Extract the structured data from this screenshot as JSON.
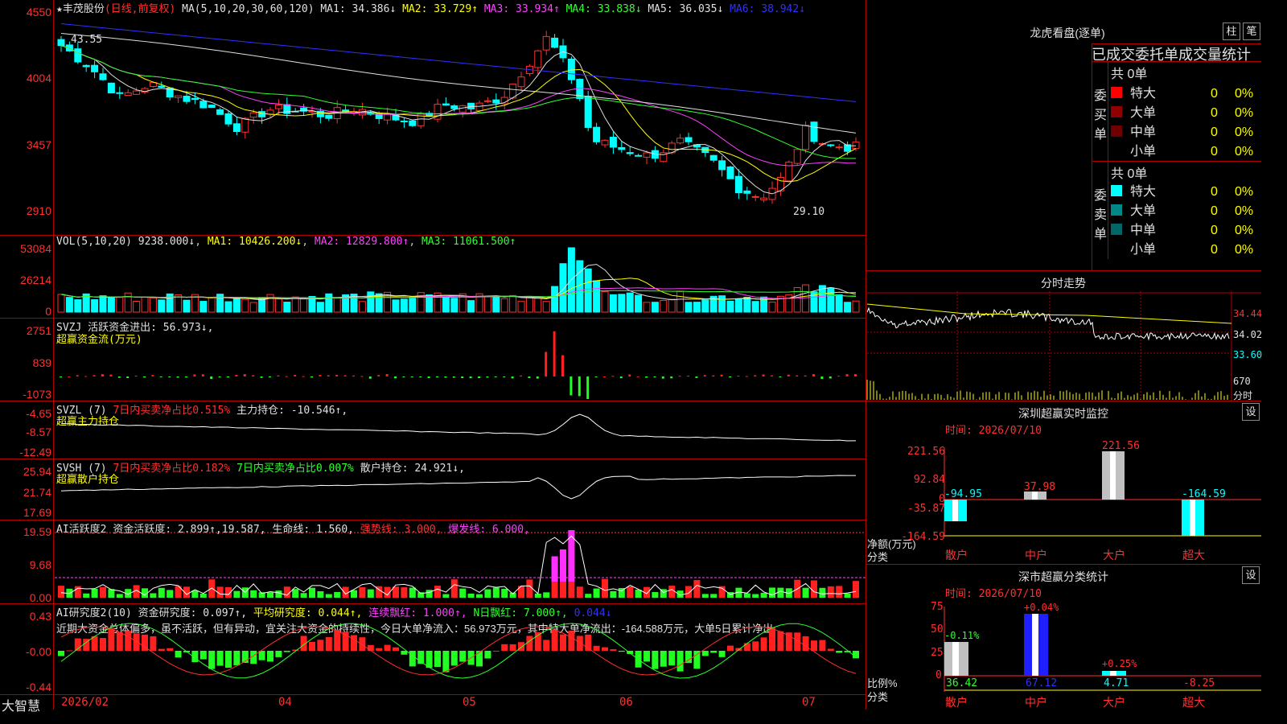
{
  "header": {
    "star": "★",
    "stock": "丰茂股份",
    "period": "(日线,前复权)",
    "ma_label": "MA(5,10,20,30,60,120)",
    "ma": [
      {
        "k": "MA1:",
        "v": "34.386↓",
        "c": "#e0e0e0"
      },
      {
        "k": "MA2:",
        "v": "33.729↑",
        "c": "#ffff00"
      },
      {
        "k": "MA3:",
        "v": "33.934↑",
        "c": "#ff40ff"
      },
      {
        "k": "MA4:",
        "v": "33.838↓",
        "c": "#30ff30"
      },
      {
        "k": "MA5:",
        "v": "36.035↓",
        "c": "#e0e0e0"
      },
      {
        "k": "MA6:",
        "v": "38.942↓",
        "c": "#3030ff"
      }
    ]
  },
  "price": {
    "yticks": [
      "4550",
      "4004",
      "3457",
      "2910"
    ],
    "high_label": "43.55",
    "low_label": "29.10"
  },
  "vol": {
    "title": "VOL(5,10,20)",
    "value": "9238.000↓",
    "ma1": "MA1: 10426.200↓",
    "ma2": "MA2: 12829.800↑",
    "ma3": "MA3: 11061.500↑",
    "yticks": [
      "53084",
      "26214",
      "0"
    ]
  },
  "svzj": {
    "title": "SVZJ  活跃资金进出: 56.973↓,",
    "sub": "超赢资金流(万元)",
    "yticks": [
      "2751",
      "839",
      "-1073"
    ]
  },
  "svzl": {
    "title": "SVZL (7)",
    "t1": "7日内买卖净占比0.515%",
    "t2": "主力持仓: -10.546↑,",
    "sub": "超赢主力持仓",
    "yticks": [
      "-4.65",
      "-8.57",
      "-12.49"
    ]
  },
  "svsh": {
    "title": "SVSH (7)",
    "t1": "7日内买卖净占比0.182%",
    "t2": "7日内买卖净占比0.007%",
    "t3": "散户持仓: 24.921↓,",
    "sub": "超赢散户持仓",
    "yticks": [
      "25.94",
      "21.74",
      "17.69"
    ]
  },
  "ai1": {
    "title": "AI活跃度2",
    "t1": "资金活跃度: 2.899↑,19.587,",
    "t2": "生命线: 1.560,",
    "t3": "强势线: 3.000,",
    "t4": "爆发线: 6.000,",
    "yticks": [
      "19.59",
      "9.68",
      "0.00"
    ]
  },
  "ai2": {
    "title": "AI研究度2(10)",
    "t1": "资金研究度: 0.097↑,",
    "t2": "平均研究度: 0.044↑,",
    "t3": "连续飘红: 1.000↑,",
    "t4": "N日飘红: 7.000↑,",
    "t5": "0.044↓",
    "text": "近期大资金总体偏多，虽不活跃，但有异动，宜关注大资金的持续性，今日大单净流入：56.973万元，其中特大单净流出：-164.588万元，大单5日累计净出",
    "yticks": [
      "0.43",
      "-0.00",
      "-0.44"
    ]
  },
  "footer": {
    "brand": "大智慧",
    "dates": [
      "2026/02",
      "04",
      "05",
      "06",
      "07"
    ]
  },
  "lhb": {
    "title": "龙虎看盘(逐单)",
    "btn1": "柱",
    "btn2": "笔",
    "subtitle": "已成交委托单成交量统计",
    "buy_label": "委买单",
    "sell_label": "委卖单",
    "buy_total": "共 0单",
    "sell_total": "共 0单",
    "buy": [
      {
        "name": "特大",
        "n": "0",
        "p": "0%",
        "c": "#ff0000"
      },
      {
        "name": "大单",
        "n": "0",
        "p": "0%",
        "c": "#900000"
      },
      {
        "name": "中单",
        "n": "0",
        "p": "0%",
        "c": "#700000"
      },
      {
        "name": "小单",
        "n": "0",
        "p": "0%",
        "c": "#000000"
      }
    ],
    "sell": [
      {
        "name": "特大",
        "n": "0",
        "p": "0%",
        "c": "#00ffff"
      },
      {
        "name": "大单",
        "n": "0",
        "p": "0%",
        "c": "#008888"
      },
      {
        "name": "中单",
        "n": "0",
        "p": "0%",
        "c": "#006666"
      },
      {
        "name": "小单",
        "n": "0",
        "p": "0%",
        "c": "#000000"
      }
    ]
  },
  "fenshi": {
    "title": "分时走势",
    "yticks": [
      "34.44",
      "34.02",
      "33.60",
      "670"
    ],
    "vol_label": "分时"
  },
  "sz": {
    "title": "深圳超赢实时监控",
    "btn": "设",
    "time": "时间: 2026/07/10",
    "yticks": [
      "221.56",
      "92.84",
      "0",
      "-35.87",
      "-164.59"
    ],
    "ylabel1": "净额(万元)",
    "ylabel2": "分类",
    "bars": [
      {
        "cat": "散户",
        "v": "-94.95"
      },
      {
        "cat": "中户",
        "v": "37.98"
      },
      {
        "cat": "大户",
        "v": "221.56"
      },
      {
        "cat": "超大",
        "v": "-164.59"
      }
    ]
  },
  "szfl": {
    "title": "深市超赢分类统计",
    "btn": "设",
    "time": "时间: 2026/07/10",
    "yticks": [
      "75",
      "50",
      "25",
      "0"
    ],
    "ylabel1": "比例%",
    "ylabel2": "分类",
    "bars": [
      {
        "cat": "散户",
        "v": "36.42",
        "d": "-0.11%"
      },
      {
        "cat": "中户",
        "v": "67.12",
        "d": "+0.04%"
      },
      {
        "cat": "大户",
        "v": "4.71",
        "d": "+0.25%"
      },
      {
        "cat": "超大",
        "v": "-8.25",
        "d": ""
      }
    ]
  }
}
